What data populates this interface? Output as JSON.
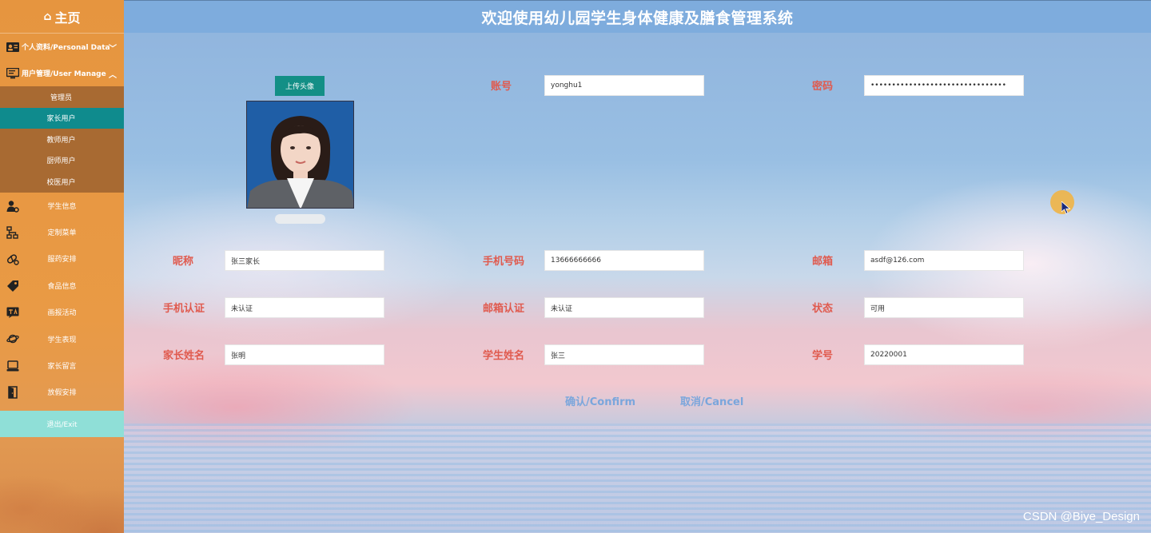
{
  "sidebar": {
    "home_label": "主页",
    "personal_data": "个人资料/Personal Data",
    "user_manage": "用户管理/User Manage",
    "sub_items": [
      {
        "label": "管理员"
      },
      {
        "label": "家长用户"
      },
      {
        "label": "教师用户"
      },
      {
        "label": "厨师用户"
      },
      {
        "label": "校医用户"
      }
    ],
    "nav_items": [
      {
        "label": "学生信息"
      },
      {
        "label": "定制菜单"
      },
      {
        "label": "服药安排"
      },
      {
        "label": "食品信息"
      },
      {
        "label": "画报活动"
      },
      {
        "label": "学生表现"
      },
      {
        "label": "家长留言"
      },
      {
        "label": "放假安排"
      }
    ],
    "exit_label": "退出/Exit"
  },
  "header": {
    "title": "欢迎使用幼儿园学生身体健康及膳食管理系统"
  },
  "form": {
    "upload_label": "上传头像",
    "account": {
      "label": "账号",
      "value": "yonghu1"
    },
    "password": {
      "label": "密码",
      "value": "••••••••••••••••••••••••••••••••"
    },
    "nickname": {
      "label": "昵称",
      "value": "张三家长"
    },
    "phone": {
      "label": "手机号码",
      "value": "13666666666"
    },
    "email": {
      "label": "邮箱",
      "value": "asdf@126.com"
    },
    "phone_verify": {
      "label": "手机认证",
      "value": "未认证"
    },
    "email_verify": {
      "label": "邮箱认证",
      "value": "未认证"
    },
    "status": {
      "label": "状态",
      "value": "可用"
    },
    "parent_name": {
      "label": "家长姓名",
      "value": "张明"
    },
    "student_name": {
      "label": "学生姓名",
      "value": "张三"
    },
    "student_id": {
      "label": "学号",
      "value": "20220001"
    },
    "confirm_label": "确认/Confirm",
    "cancel_label": "取消/Cancel"
  },
  "watermark": "CSDN @Biye_Design",
  "colors": {
    "sidebar": "#e6953f",
    "submenu": "#a86a32",
    "active": "#0f8b8d",
    "exit": "#8fdfd7",
    "label": "#e05a4e",
    "button_text": "#7aa6dc"
  }
}
